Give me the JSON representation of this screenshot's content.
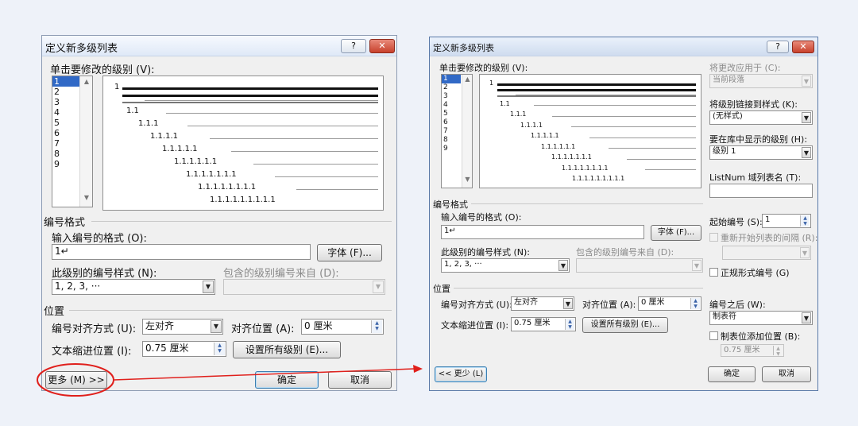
{
  "left_dialog": {
    "title": "定义新多级列表",
    "help_btn": "?",
    "close_btn": "✕",
    "level_label": "单击要修改的级别 (V):",
    "levels": [
      "1",
      "2",
      "3",
      "4",
      "5",
      "6",
      "7",
      "8",
      "9"
    ],
    "preview_levels": [
      "1",
      "1.1",
      "1.1.1",
      "1.1.1.1",
      "1.1.1.1.1",
      "1.1.1.1.1.1",
      "1.1.1.1.1.1.1",
      "1.1.1.1.1.1.1.1",
      "1.1.1.1.1.1.1.1.1"
    ],
    "number_format_group": "编号格式",
    "enter_format_label": "输入编号的格式 (O):",
    "format_value": "1↵",
    "font_button": "字体 (F)...",
    "style_label": "此级别的编号样式 (N):",
    "style_value": "1, 2, 3, ···",
    "include_label": "包含的级别编号来自 (D):",
    "position_group": "位置",
    "align_label": "编号对齐方式 (U):",
    "align_value": "左对齐",
    "align_at_label": "对齐位置 (A):",
    "align_at_value": "0 厘米",
    "indent_label": "文本缩进位置 (I):",
    "indent_value": "0.75 厘米",
    "set_all_button": "设置所有级别 (E)...",
    "more_button": "更多 (M) >>",
    "ok_button": "确定",
    "cancel_button": "取消"
  },
  "right_dialog": {
    "title": "定义新多级列表",
    "help_btn": "?",
    "close_btn": "✕",
    "level_label": "单击要修改的级别 (V):",
    "levels": [
      "1",
      "2",
      "3",
      "4",
      "5",
      "6",
      "7",
      "8",
      "9"
    ],
    "preview_levels": [
      "1",
      "1.1",
      "1.1.1",
      "1.1.1.1",
      "1.1.1.1.1",
      "1.1.1.1.1.1",
      "1.1.1.1.1.1.1",
      "1.1.1.1.1.1.1.1",
      "1.1.1.1.1.1.1.1.1"
    ],
    "apply_to_label": "将更改应用于 (C):",
    "apply_to_value": "当前段落",
    "link_style_label": "将级别链接到样式 (K):",
    "link_style_value": "(无样式)",
    "gallery_level_label": "要在库中显示的级别 (H):",
    "gallery_level_value": "级别 1",
    "listnum_label": "ListNum 域列表名 (T):",
    "listnum_value": "",
    "number_format_group": "编号格式",
    "enter_format_label": "输入编号的格式 (O):",
    "format_value": "1↵",
    "font_button": "字体 (F)...",
    "style_label": "此级别的编号样式 (N):",
    "style_value": "1, 2, 3, ···",
    "include_label": "包含的级别编号来自 (D):",
    "start_at_label": "起始编号 (S):",
    "start_at_value": "1",
    "restart_label": "重新开始列表的间隔 (R):",
    "legal_label": "正规形式编号 (G)",
    "position_group": "位置",
    "align_label": "编号对齐方式 (U):",
    "align_value": "左对齐",
    "align_at_label": "对齐位置 (A):",
    "align_at_value": "0 厘米",
    "indent_label": "文本缩进位置 (I):",
    "indent_value": "0.75 厘米",
    "set_all_button": "设置所有级别 (E)...",
    "follow_label": "编号之后 (W):",
    "follow_value": "制表符",
    "tab_stop_label": "制表位添加位置 (B):",
    "tab_stop_value": "0.75 厘米",
    "less_button": "<< 更少 (L)",
    "ok_button": "确定",
    "cancel_button": "取消"
  },
  "annotation": {
    "color": "#e0201c"
  }
}
